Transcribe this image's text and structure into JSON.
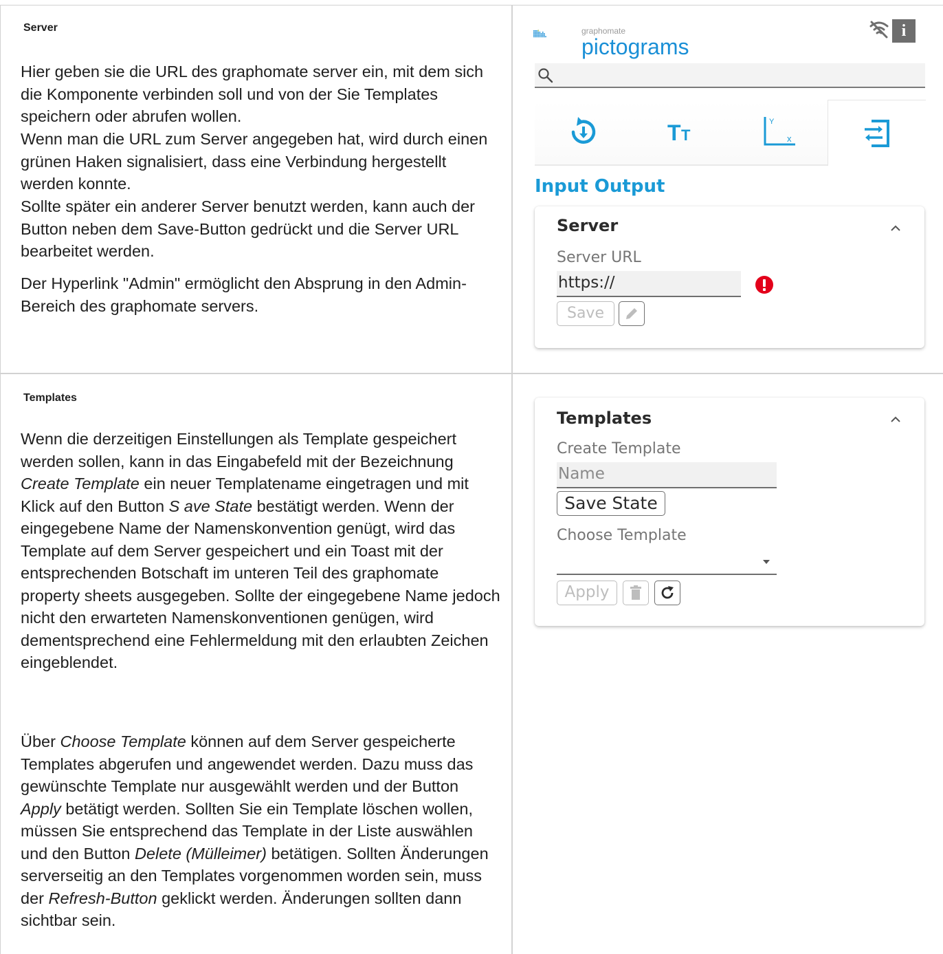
{
  "left": {
    "server": {
      "heading": "Server",
      "para1": "Hier geben sie die URL des graphomate server ein, mit dem sich die Komponente verbinden soll und von der Sie Templates speichern oder abrufen wollen.",
      "para2": "Wenn man die URL zum Server angegeben hat, wird durch einen grünen Haken signalisiert, dass eine Verbindung hergestellt werden konnte.",
      "para3": "Sollte später ein anderer Server benutzt werden, kann auch der Button neben dem Save-Button gedrückt und die Server URL bearbeitet werden.",
      "para4": "Der Hyperlink \"Admin\" ermöglicht den Absprung in den Admin-Bereich des graphomate servers."
    },
    "templates": {
      "heading": "Templates",
      "p1_a": "Wenn die derzeitigen Einstellungen als Template gespeichert werden sollen, kann in das Eingabefeld mit der Bezeichnung ",
      "p1_em1": "Create Template",
      "p1_b": " ein neuer Templatename eingetragen und mit Klick auf den Button ",
      "p1_em2": "S ave State",
      "p1_c": " bestätigt werden. Wenn der eingegebene Name der Namenskonvention genügt, wird das Template auf dem Server gespeichert und ein Toast mit der entsprechenden Botschaft im unteren Teil des graphomate property sheets ausgegeben. Sollte der eingegebene Name jedoch nicht den erwarteten Namenskonventionen genügen, wird dementsprechend eine Fehlermeldung mit den erlaubten Zeichen eingeblendet.",
      "p2_a": "Über ",
      "p2_em1": "Choose Template",
      "p2_b": " können auf dem Server gespeicherte Templates abgerufen und angewendet werden. Dazu muss das gewünschte Template nur ausgewählt werden und der Button ",
      "p2_em2": "Apply",
      "p2_c": " betätigt werden. Sollten Sie ein Template löschen wollen, müssen Sie entsprechend das Template in der Liste auswählen und den Button ",
      "p2_em3": "Delete (Mülleimer)",
      "p2_d": " betätigen. Sollten Änderungen serverseitig an den Templates vorgenommen worden sein, muss der ",
      "p2_em4": "Refresh-Button",
      "p2_e": " geklickt werden. Änderungen sollten dann sichtbar sein."
    }
  },
  "panel": {
    "logo_small": "graphomate",
    "logo_big": "pictograms",
    "section_title": "Input Output",
    "server_card": {
      "title": "Server",
      "url_label": "Server URL",
      "url_value": "https://",
      "save_label": "Save"
    },
    "templates_card": {
      "title": "Templates",
      "create_label": "Create Template",
      "name_placeholder": "Name",
      "save_state_label": "Save State",
      "choose_label": "Choose Template",
      "apply_label": "Apply"
    },
    "colors": {
      "accent": "#1a9ad6",
      "error": "#e3001b",
      "logo_blue": "#1a8fd6"
    },
    "icons": [
      "search-icon",
      "wifi-off-icon",
      "info-icon",
      "reset-icon",
      "text-size-icon",
      "axis-icon",
      "input-output-icon",
      "chevron-up-icon",
      "error-icon",
      "pencil-icon",
      "trash-icon",
      "refresh-icon"
    ]
  }
}
